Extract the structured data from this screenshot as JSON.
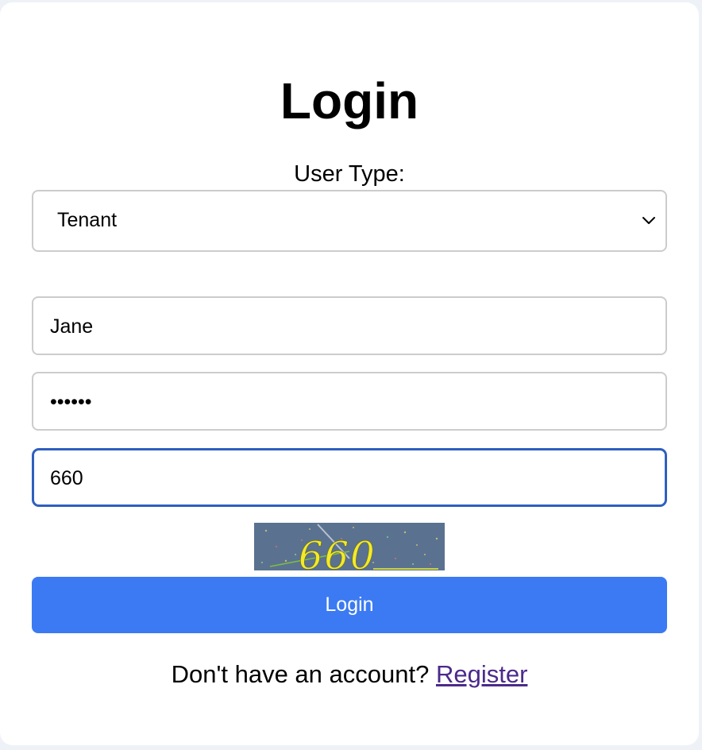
{
  "title": "Login",
  "user_type_label": "User Type:",
  "user_type_select": {
    "selected": "Tenant"
  },
  "username_field": {
    "value": "Jane"
  },
  "password_field": {
    "value": "••••••"
  },
  "captcha_field": {
    "value": "660"
  },
  "captcha_image": {
    "text": "660"
  },
  "login_button_label": "Login",
  "footer": {
    "prompt": "Don't have an account?",
    "register_link": "Register"
  },
  "colors": {
    "primary_button": "#3b7af3",
    "link": "#4b2a8a",
    "focus_border": "#2f5fbf"
  }
}
